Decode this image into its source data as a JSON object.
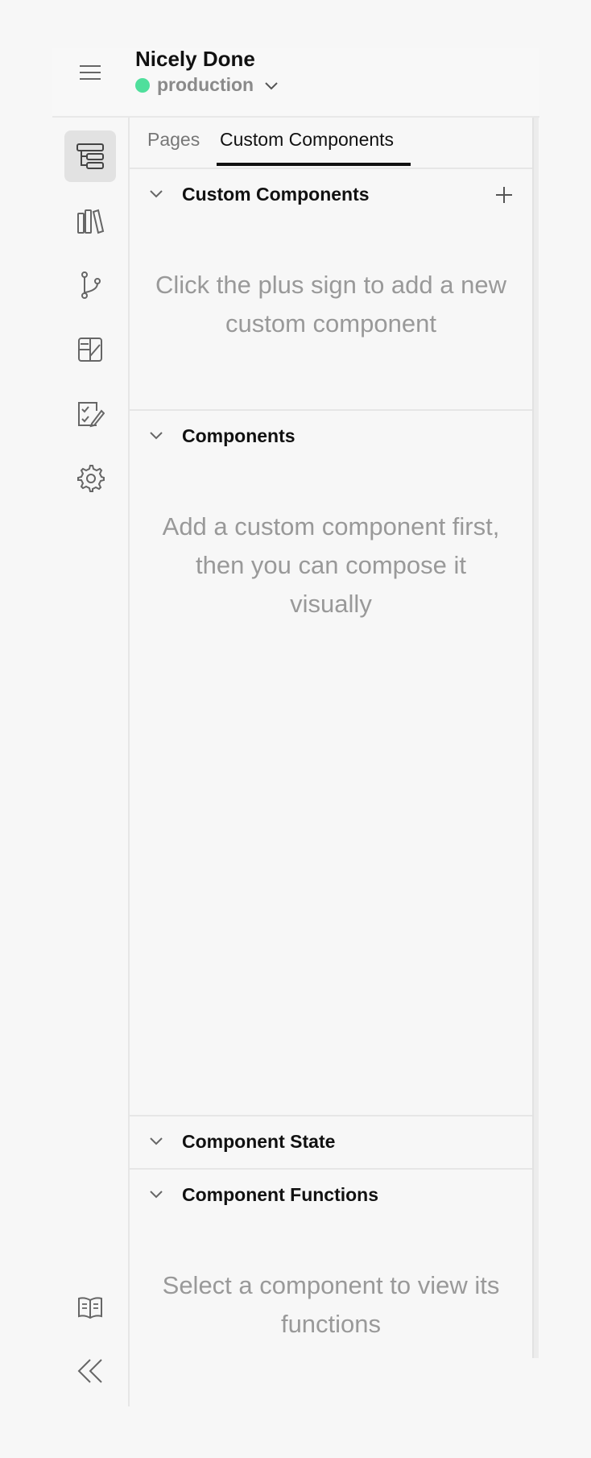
{
  "header": {
    "project_name": "Nicely Done",
    "environment": "production",
    "environment_color": "#4fdf9c"
  },
  "rail": {
    "items": [
      {
        "icon": "component-tree-icon",
        "active": true
      },
      {
        "icon": "library-icon",
        "active": false
      },
      {
        "icon": "branch-icon",
        "active": false
      },
      {
        "icon": "design-tokens-icon",
        "active": false
      },
      {
        "icon": "tasks-icon",
        "active": false
      },
      {
        "icon": "gear-icon",
        "active": false
      }
    ],
    "bottom": [
      {
        "icon": "docs-book-icon"
      },
      {
        "icon": "collapse-double-chevron-icon"
      }
    ]
  },
  "tabs": {
    "pages": "Pages",
    "custom_components": "Custom Components",
    "active": "custom_components"
  },
  "sections": {
    "custom_components": {
      "title": "Custom Components",
      "empty": "Click the plus sign to add a new custom component"
    },
    "components": {
      "title": "Components",
      "empty": "Add a custom component first, then you can compose it visually"
    },
    "component_state": {
      "title": "Component State"
    },
    "component_functions": {
      "title": "Component Functions",
      "empty": "Select a component to view its functions"
    }
  }
}
